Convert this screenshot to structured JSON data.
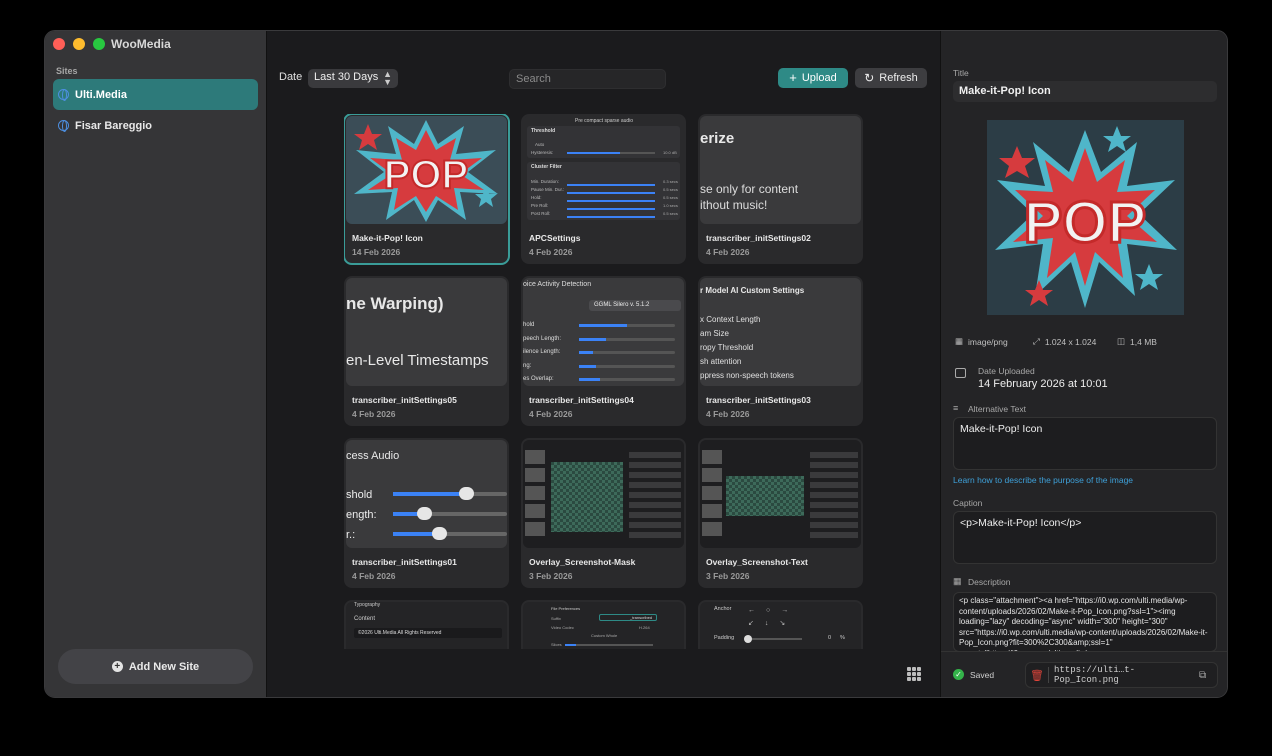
{
  "app": {
    "title": "WooMedia"
  },
  "sidebar": {
    "section_label": "Sites",
    "sites": [
      {
        "label": "Ulti.Media",
        "active": true
      },
      {
        "label": "Fisar Bareggio",
        "active": false
      }
    ],
    "add_site_label": "Add New Site"
  },
  "toolbar": {
    "date_label": "Date",
    "date_filter": "Last 30 Days",
    "search_placeholder": "Search",
    "upload_label": "Upload",
    "refresh_label": "Refresh"
  },
  "media": [
    {
      "name": "Make-it-Pop! Icon",
      "date": "14 Feb 2026",
      "selected": true
    },
    {
      "name": "APCSettings",
      "date": "4 Feb 2026"
    },
    {
      "name": "transcriber_initSettings02",
      "date": "4 Feb 2026"
    },
    {
      "name": "transcriber_initSettings05",
      "date": "4 Feb 2026"
    },
    {
      "name": "transcriber_initSettings04",
      "date": "4 Feb 2026"
    },
    {
      "name": "transcriber_initSettings03",
      "date": "4 Feb 2026"
    },
    {
      "name": "transcriber_initSettings01",
      "date": "4 Feb 2026"
    },
    {
      "name": "Overlay_Screenshot-Mask",
      "date": "3 Feb 2026"
    },
    {
      "name": "Overlay_Screenshot-Text",
      "date": "3 Feb 2026"
    }
  ],
  "thumbs": {
    "pop": "POP",
    "apc_head": "Pre compact sparse audio",
    "apc_threshold": "Threshold",
    "apc_auto": "Auto",
    "apc_hysteresis": "Hysteresis:",
    "apc_cluster": "Cluster Filter",
    "apc_rows": [
      "Min. Duration:",
      "Pause Min. Dur.:",
      "Hold:",
      "Pre Roll:",
      "Post Roll:"
    ],
    "apc_vals": [
      "10.0 dB",
      "0.3 secs",
      "0.5 secs",
      "0.5 secs",
      "1.0 secs",
      "0.5 secs"
    ],
    "t02_title": "erize",
    "t02_line1": "se only for content",
    "t02_line2": "ithout music!",
    "t05_title": "ne Warping)",
    "t05_line": "en-Level Timestamps",
    "t04_title": "oice Activity Detection",
    "t04_select": "GGML Silero v. 5.1.2",
    "t04_rows": [
      "hold",
      "peech Length:",
      "ilence Length:",
      "ng:",
      "es Overlap:"
    ],
    "t03_title": "r Model AI Custom Settings",
    "t03_rows": [
      "x Context Length",
      "am Size",
      "ropy Threshold",
      "sh attention",
      "ppress non-speech tokens"
    ],
    "t01_title": "cess Audio",
    "t01_rows": [
      "shold",
      "ength:",
      "r.:"
    ],
    "row4a_head": "Typography",
    "row4a_label": "Content",
    "row4a_text": "©2026 Ulti.Media    All Rights Reserved",
    "row4b_head": "File Preferences",
    "row4b_suffix": "Suffix",
    "row4b_suffix_val": "_transcribed",
    "row4b_codec": "Video Codec",
    "row4b_codec_val": "H.264",
    "row4b_check": "Custom Whole",
    "row4b_slider": "Slices",
    "row4c_anchor": "Anchor",
    "row4c_padding": "Padding",
    "row4c_pad_val": "0",
    "row4c_pad_unit": "%"
  },
  "details": {
    "title_label": "Title",
    "title_value": "Make-it-Pop! Icon",
    "mime": "image/png",
    "dimensions": "1.024 x 1.024",
    "size": "1,4 MB",
    "date_label": "Date Uploaded",
    "date_value": "14 February 2026 at 10:01",
    "alt_label": "Alternative Text",
    "alt_value": "Make-it-Pop! Icon",
    "alt_help_link": "Learn how to describe the purpose of the image",
    "caption_label": "Caption",
    "caption_value": "<p>Make-it-Pop! Icon</p>",
    "description_label": "Description",
    "description_value": "<p class=\"attachment\"><a href=\"https://i0.wp.com/ulti.media/wp-content/uploads/2026/02/Make-it-Pop_Icon.png?ssl=1\"><img loading=\"lazy\" decoding=\"async\" width=\"300\" height=\"300\" src=\"https://i0.wp.com/ulti.media/wp-content/uploads/2026/02/Make-it-Pop_Icon.png?fit=300%2C300&amp;ssl=1\" srcset=\"https://i0.wp.com/ulti.media/wp-content/uploads/2026/02/Make-it-Pop_Icon.png",
    "status": "Saved",
    "url": "https://ulti…t-Pop_Icon.png"
  },
  "colors": {
    "accent": "#2e8a86",
    "selected_site": "#2d7a7a",
    "link": "#3ea0d8",
    "saved": "#34b34a",
    "delete": "#e0443a"
  }
}
